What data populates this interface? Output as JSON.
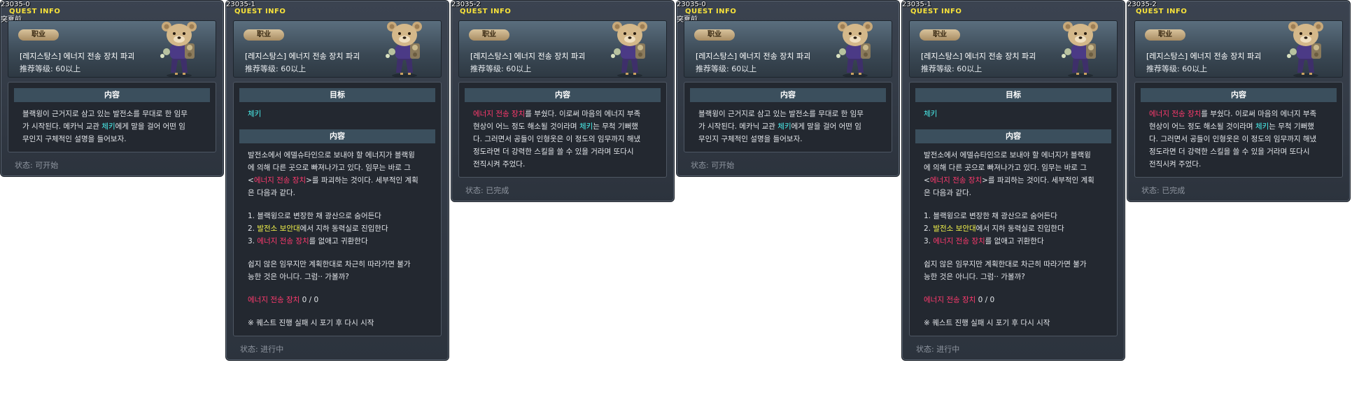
{
  "panels": [
    {
      "id": "23035-0",
      "title": "QUEST INFO",
      "note": "突夏前",
      "category": "职业",
      "name": "[레지스탕스] 에너지 전송 장치 파괴",
      "level": "推荐等级:  60以上",
      "sections": [
        {
          "heading": "内容",
          "lines": [
            [
              {
                "t": "블랙윙이 근거지로 삼고 있는 발전소를 무대로 한 임무",
                "c": "w"
              }
            ],
            [
              {
                "t": "가 시작된다. 메카닉 교관 ",
                "c": "w"
              },
              {
                "t": "체키",
                "c": "c"
              },
              {
                "t": "에게 말을 걸어 어떤 임",
                "c": "w"
              }
            ],
            [
              {
                "t": "무인지 구체적인 설명을 들어보자.",
                "c": "w"
              }
            ]
          ]
        }
      ],
      "status": "状态:  可开始"
    },
    {
      "id": "23035-1",
      "title": "QUEST INFO",
      "note": "",
      "category": "职业",
      "name": "[레지스탕스] 에너지 전송 장치 파괴",
      "level": "推荐等级:  60以上",
      "sections": [
        {
          "heading": "目标",
          "lines": [
            [
              {
                "t": "체키",
                "c": "c"
              }
            ]
          ]
        },
        {
          "heading": "内容",
          "lines": [
            [
              {
                "t": "발전소에서 에델슈타인으로 보내야 할 에너지가 블랙윙",
                "c": "w"
              }
            ],
            [
              {
                "t": "에 의해 다른 곳으로 빠져나가고 있다. 임무는 바로 그",
                "c": "w"
              }
            ],
            [
              {
                "t": "<",
                "c": "w"
              },
              {
                "t": "에너지 전송 장치",
                "c": "p"
              },
              {
                "t": ">를 파괴하는 것이다. 세부적인 계획",
                "c": "w"
              }
            ],
            [
              {
                "t": "은 다음과 같다.",
                "c": "w"
              }
            ],
            [],
            [
              {
                "t": "1. 블랙윙으로 변장한 채 광산으로 숨어든다",
                "c": "w"
              }
            ],
            [
              {
                "t": "2. ",
                "c": "w"
              },
              {
                "t": "발전소 보안대",
                "c": "y"
              },
              {
                "t": "에서 지하 동력실로 진입한다",
                "c": "w"
              }
            ],
            [
              {
                "t": "3. ",
                "c": "w"
              },
              {
                "t": "에너지 전송 장치",
                "c": "p"
              },
              {
                "t": "를 없애고 귀환한다",
                "c": "w"
              }
            ],
            [],
            [
              {
                "t": "쉽지 않은 임무지만 계획한대로 차근히 따라가면 불가",
                "c": "w"
              }
            ],
            [
              {
                "t": "능한 것은 아니다. 그럼·· 가볼까?",
                "c": "w"
              }
            ],
            [],
            [
              {
                "t": "에너지 전송 장치",
                "c": "p"
              },
              {
                "t": " 0 / 0",
                "c": "w"
              }
            ],
            [],
            [
              {
                "t": "※ 퀘스트 진행 실패 시 포기 후 다시 시작",
                "c": "w"
              }
            ]
          ]
        }
      ],
      "status": "状态:  进行中"
    },
    {
      "id": "23035-2",
      "title": "QUEST INFO",
      "note": "",
      "category": "职业",
      "name": "[레지스탕스] 에너지 전송 장치 파괴",
      "level": "推荐等级:  60以上",
      "sections": [
        {
          "heading": "内容",
          "lines": [
            [
              {
                "t": "에너지 전송 장치",
                "c": "p"
              },
              {
                "t": "를 부쉈다. 이로써 마음의 에너지 부족",
                "c": "w"
              }
            ],
            [
              {
                "t": "현상이 어느 정도 해소될 것이라며 ",
                "c": "w"
              },
              {
                "t": "체키",
                "c": "c"
              },
              {
                "t": "는 무척 기뻐했",
                "c": "w"
              }
            ],
            [
              {
                "t": "다. 그러면서 공들이 인형옷은 이 정도의 임무까지 해냈",
                "c": "w"
              }
            ],
            [
              {
                "t": "정도라면 더 강력한 스킬을 쓸 수 있을 거라며 또다시",
                "c": "w"
              }
            ],
            [
              {
                "t": "전직시켜 주었다.",
                "c": "w"
              }
            ]
          ]
        }
      ],
      "status": "状态:  已完成"
    },
    {
      "id": "23035-0",
      "title": "QUEST INFO",
      "note": "突夏前",
      "category": "职业",
      "name": "[레지스탕스] 에너지 전송 장치 파괴",
      "level": "推荐等级:  60以上",
      "sections": [
        {
          "heading": "内容",
          "lines": [
            [
              {
                "t": "블랙윙이 근거지로 삼고 있는 발전소를 무대로 한 임무",
                "c": "w"
              }
            ],
            [
              {
                "t": "가 시작된다. 메카닉 교관 ",
                "c": "w"
              },
              {
                "t": "체키",
                "c": "c"
              },
              {
                "t": "에게 말을 걸어 어떤 임",
                "c": "w"
              }
            ],
            [
              {
                "t": "무인지 구체적인 설명을 들어보자.",
                "c": "w"
              }
            ]
          ]
        }
      ],
      "status": "状态:  可开始"
    },
    {
      "id": "23035-1",
      "title": "QUEST INFO",
      "note": "",
      "category": "职业",
      "name": "[레지스탕스] 에너지 전송 장치 파괴",
      "level": "推荐等级:  60以上",
      "sections": [
        {
          "heading": "目标",
          "lines": [
            [
              {
                "t": "체키",
                "c": "c"
              }
            ]
          ]
        },
        {
          "heading": "内容",
          "lines": [
            [
              {
                "t": "발전소에서 에델슈타인으로 보내야 할 에너지가 블랙윙",
                "c": "w"
              }
            ],
            [
              {
                "t": "에 의해 다른 곳으로 빠져나가고 있다. 임무는 바로 그",
                "c": "w"
              }
            ],
            [
              {
                "t": "<",
                "c": "w"
              },
              {
                "t": "에너지 전송 장치",
                "c": "p"
              },
              {
                "t": ">를 파괴하는 것이다. 세부적인 계획",
                "c": "w"
              }
            ],
            [
              {
                "t": "은 다음과 같다.",
                "c": "w"
              }
            ],
            [],
            [
              {
                "t": "1. 블랙윙으로 변장한 채 광산으로 숨어든다",
                "c": "w"
              }
            ],
            [
              {
                "t": "2. ",
                "c": "w"
              },
              {
                "t": "발전소 보안대",
                "c": "y"
              },
              {
                "t": "에서 지하 동력실로 진입한다",
                "c": "w"
              }
            ],
            [
              {
                "t": "3. ",
                "c": "w"
              },
              {
                "t": "에너지 전송 장치",
                "c": "p"
              },
              {
                "t": "를 없애고 귀환한다",
                "c": "w"
              }
            ],
            [],
            [
              {
                "t": "쉽지 않은 임무지만 계획한대로 차근히 따라가면 불가",
                "c": "w"
              }
            ],
            [
              {
                "t": "능한 것은 아니다. 그럼·· 가볼까?",
                "c": "w"
              }
            ],
            [],
            [
              {
                "t": "에너지 전송 장치",
                "c": "p"
              },
              {
                "t": " 0 / 0",
                "c": "w"
              }
            ],
            [],
            [
              {
                "t": "※ 퀘스트 진행 실패 시 포기 후 다시 시작",
                "c": "w"
              }
            ]
          ]
        }
      ],
      "status": "状态:  进行中"
    },
    {
      "id": "23035-2",
      "title": "QUEST INFO",
      "note": "",
      "category": "职业",
      "name": "[레지스탕스] 에너지 전송 장치 파괴",
      "level": "推荐等级:  60以上",
      "sections": [
        {
          "heading": "内容",
          "lines": [
            [
              {
                "t": "에너지 전송 장치",
                "c": "p"
              },
              {
                "t": "를 부쉈다. 이로써 마음의 에너지 부족",
                "c": "w"
              }
            ],
            [
              {
                "t": "현상이 어느 정도 해소될 것이라며 ",
                "c": "w"
              },
              {
                "t": "체키",
                "c": "c"
              },
              {
                "t": "는 무척 기뻐했",
                "c": "w"
              }
            ],
            [
              {
                "t": "다. 그러면서 공들이 인형옷은 이 정도의 임무까지 해냈",
                "c": "w"
              }
            ],
            [
              {
                "t": "정도라면 더 강력한 스킬을 쓸 수 있을 거라며 또다시",
                "c": "w"
              }
            ],
            [
              {
                "t": "전직시켜 주었다.",
                "c": "w"
              }
            ]
          ]
        }
      ],
      "status": "状态:  已完成"
    }
  ]
}
